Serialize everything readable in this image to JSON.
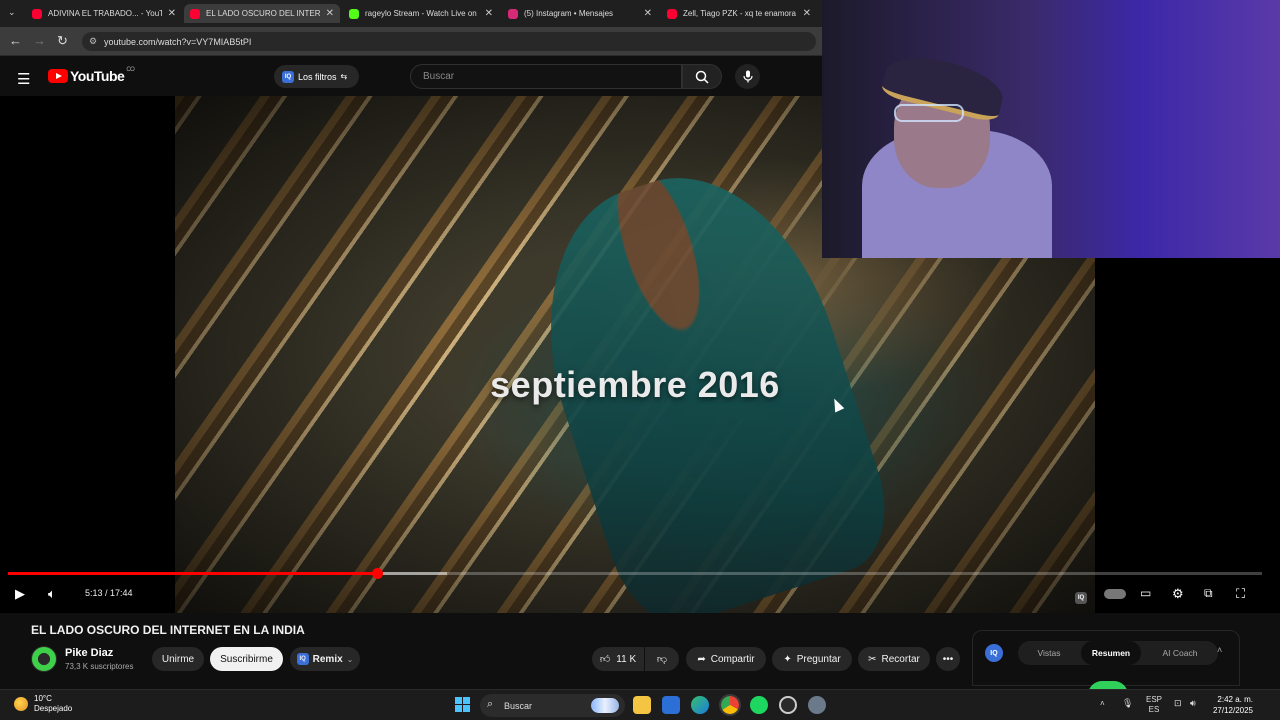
{
  "browser": {
    "tabs": [
      {
        "label": "ADIVINA EL TRABADO... - YouT",
        "favicon_color": "#ff0033",
        "active": false
      },
      {
        "label": "EL LADO OSCURO DEL INTERN",
        "favicon_color": "#ff0033",
        "active": true
      },
      {
        "label": "rageylo Stream - Watch Live on",
        "favicon_color": "#53fc18",
        "active": false
      },
      {
        "label": "(5) Instagram • Mensajes",
        "favicon_color": "#d62976",
        "active": false
      },
      {
        "label": "Zell, Tiago PZK - xq te enamora",
        "favicon_color": "#ff0033",
        "active": false
      }
    ],
    "url": "youtube.com/watch?v=VY7MIAB5tPI"
  },
  "youtube_header": {
    "logo_text": "YouTube",
    "region": "CO",
    "filters_label": "Los filtros",
    "search_placeholder": "Buscar"
  },
  "player": {
    "caption": "septiembre 2016",
    "current_time": "5:13",
    "duration": "17:44",
    "time_display": "5:13 / 17:44",
    "played_fraction": 0.294,
    "buffered_fraction": 0.35,
    "accent_color": "#ff0000"
  },
  "video_info": {
    "title": "EL LADO OSCURO DEL INTERNET EN LA INDIA",
    "channel": "Pike Diaz",
    "subscribers": "73,3 K suscriptores",
    "join_label": "Unirme",
    "subscribe_label": "Suscribirme",
    "remix_label": "Remix",
    "likes": "11 K",
    "share_label": "Compartir",
    "ask_label": "Preguntar",
    "clip_label": "Recortar"
  },
  "iq_panel": {
    "options": [
      "Vistas",
      "Resumen",
      "AI Coach"
    ],
    "selected": "Resumen"
  },
  "taskbar": {
    "temperature": "10°C",
    "weather": "Despejado",
    "search_label": "Buscar",
    "lang_top": "ESP",
    "lang_bottom": "ES",
    "time": "2:42 a. m.",
    "date": "27/12/2025"
  }
}
